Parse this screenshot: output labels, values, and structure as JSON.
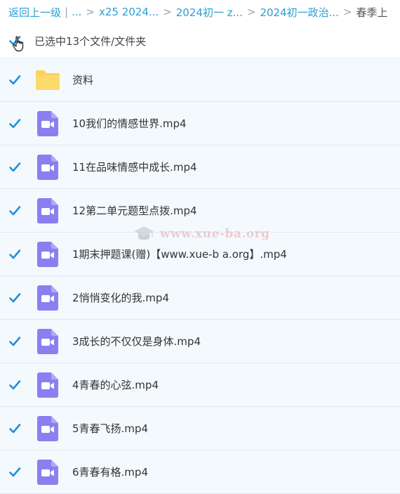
{
  "breadcrumb": {
    "back": "返回上一级",
    "divider": "|",
    "ellipsis": "...",
    "separator": ">",
    "crumbs": [
      "x25 2024...",
      "2024初一 z...",
      "2024初一政治..."
    ],
    "current": "春季上"
  },
  "selection": {
    "label": "已选中13个文件/文件夹",
    "checked": true
  },
  "files": [
    {
      "name": "资料",
      "type": "folder"
    },
    {
      "name": "10我们的情感世界.mp4",
      "type": "video"
    },
    {
      "name": "11在品味情感中成长.mp4",
      "type": "video"
    },
    {
      "name": "12第二单元题型点拨.mp4",
      "type": "video"
    },
    {
      "name": "1期末押题课(赠)【www.xue-b a.org】.mp4",
      "type": "video"
    },
    {
      "name": "2悄悄变化的我.mp4",
      "type": "video"
    },
    {
      "name": "3成长的不仅仅是身体.mp4",
      "type": "video"
    },
    {
      "name": "4青春的心弦.mp4",
      "type": "video"
    },
    {
      "name": "5青春飞扬.mp4",
      "type": "video"
    },
    {
      "name": "6青春有格.mp4",
      "type": "video"
    }
  ],
  "watermark": "www.xue-ba.org",
  "colors": {
    "accent": "#2a9fd6",
    "checkbox": "#1e90d8",
    "folder": "#fcd25a",
    "video": "#8a7ff0",
    "row_bg": "#f4f9fe"
  }
}
